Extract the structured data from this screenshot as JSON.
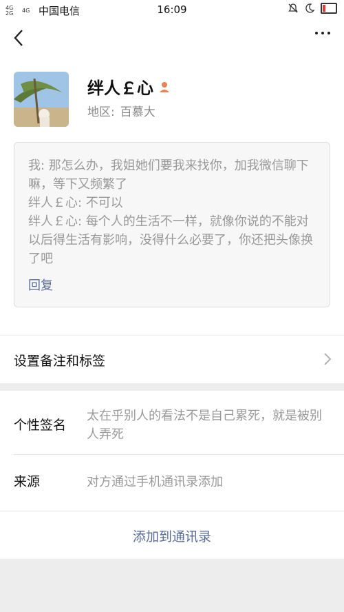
{
  "status_bar": {
    "network_1": "4G",
    "network_2": "4G",
    "network_3": "2G",
    "carrier": "中国电信",
    "time": "16:09",
    "battery_level": 0.1,
    "battery_color": "#e53935"
  },
  "nav": {
    "back_icon": "chevron-left-icon",
    "more_icon": "more-icon"
  },
  "profile": {
    "nickname": "绊人￡心",
    "gender_icon": "user-icon",
    "region_label": "地区:",
    "region_value": "百慕大"
  },
  "greeting_message": {
    "lines": [
      "我: 那怎么办，我姐她们要我来找你，加我微信聊下嘛，等下又频繁了",
      "绊人￡心: 不可以",
      "绊人￡心: 每个人的生活不一样，就像你说的不能对以后得生活有影响，没得什么必要了，你还把头像换了吧"
    ],
    "reply_label": "回复"
  },
  "remark_row": {
    "label": "设置备注和标签"
  },
  "details": {
    "signature_label": "个性签名",
    "signature_value": "太在乎别人的看法不是自己累死，就是被别人弄死",
    "source_label": "来源",
    "source_value": "对方通过手机通讯录添加"
  },
  "actions": {
    "add_contact_label": "添加到通讯录"
  },
  "colors": {
    "link": "#586b95",
    "accent_gender": "#e8825a",
    "background": "#ededed"
  }
}
